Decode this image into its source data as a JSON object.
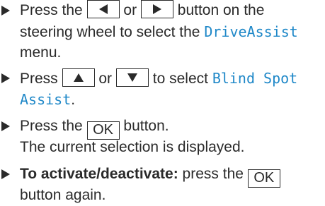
{
  "colors": {
    "text": "#2a2a2a",
    "display_text": "#1f88c8"
  },
  "steps": [
    {
      "line1": {
        "prefix": "Press the",
        "key_left_icon": "left-triangle-icon",
        "or": "or",
        "key_right_icon": "right-triangle-icon",
        "suffix": "button on the"
      },
      "line2": {
        "text": "steering wheel to select the",
        "menu_name": "DriveAssist"
      },
      "line3": {
        "text": "menu."
      }
    },
    {
      "line1": {
        "prefix": "Press",
        "key_up_icon": "up-triangle-icon",
        "or": "or",
        "key_down_icon": "down-triangle-icon",
        "suffix": "to select",
        "display_part1": "Blind Spot"
      },
      "line2": {
        "display_part2": "Assist",
        "end": "."
      }
    },
    {
      "line1": {
        "prefix": "Press the",
        "key_ok": "OK",
        "suffix": "button."
      },
      "line2": {
        "text": "The current selection is displayed."
      }
    },
    {
      "line1": {
        "bold": "To activate/deactivate:",
        "text": "press the",
        "key_ok": "OK"
      },
      "line2": {
        "text": "button again."
      }
    }
  ]
}
